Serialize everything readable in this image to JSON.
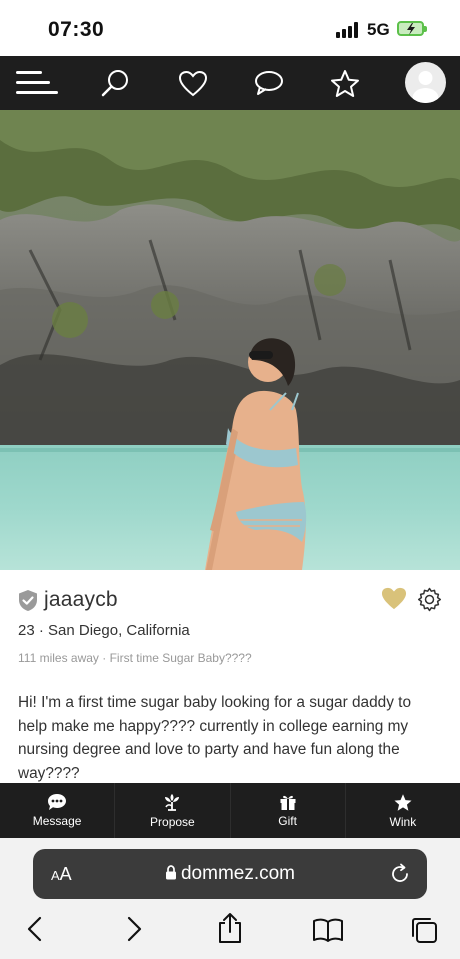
{
  "status": {
    "time": "07:30",
    "network": "5G"
  },
  "nav": {
    "menu_icon": "menu-icon",
    "search_icon": "search-icon",
    "favorites_icon": "heart-icon",
    "messages_icon": "chat-icon",
    "star_icon": "star-icon",
    "avatar": "avatar"
  },
  "profile": {
    "username": "jaaaycb",
    "age_location": "23 · San Diego, California",
    "meta": "111 miles away · First time Sugar Baby????",
    "bio": "Hi! I'm a first time sugar baby looking for a sugar daddy to help make me happy???? currently in college earning my nursing degree and love to party and have fun along the way????",
    "favorite_color": "#d9c27a"
  },
  "actions": [
    {
      "label": "Message",
      "icon": "message-icon"
    },
    {
      "label": "Propose",
      "icon": "propose-icon"
    },
    {
      "label": "Gift",
      "icon": "gift-icon"
    },
    {
      "label": "Wink",
      "icon": "star-icon"
    }
  ],
  "browser": {
    "text_size_label_small": "A",
    "text_size_label_large": "A",
    "url": "dommez.com"
  },
  "colors": {
    "nav_bg": "#1e1e1e",
    "accent_gold": "#d9c27a",
    "verified_grey": "#9a9a9a"
  }
}
